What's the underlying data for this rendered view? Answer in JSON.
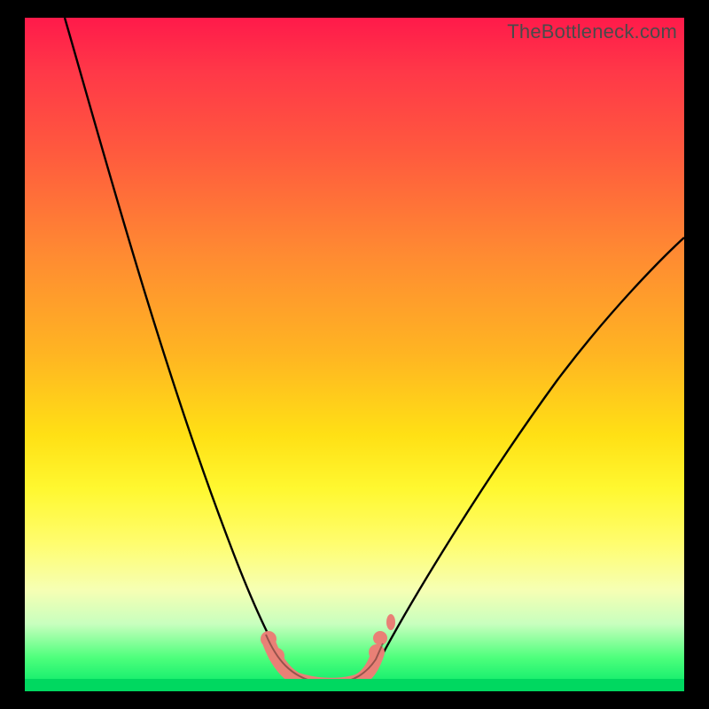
{
  "watermark": "TheBottleneck.com",
  "chart_data": {
    "type": "line",
    "title": "",
    "xlabel": "",
    "ylabel": "",
    "xlim": [
      0,
      100
    ],
    "ylim": [
      0,
      100
    ],
    "grid": false,
    "legend": false,
    "series": [
      {
        "name": "bottleneck-curve",
        "x": [
          6,
          10,
          15,
          20,
          25,
          30,
          35,
          38,
          40,
          42,
          45,
          48,
          50,
          55,
          60,
          65,
          70,
          75,
          80,
          85,
          90,
          95,
          100
        ],
        "values": [
          100,
          90,
          77,
          64,
          51,
          38,
          24,
          14,
          7,
          3,
          1,
          1,
          1.5,
          5,
          11,
          18,
          25,
          32,
          39,
          46,
          52,
          58,
          62
        ]
      }
    ],
    "markers": {
      "style": "salmon-dots-and-link",
      "points_x": [
        36.5,
        38.5,
        41,
        44,
        47,
        50,
        52,
        52.5
      ],
      "points_y": [
        7,
        4,
        1.2,
        0.8,
        0.8,
        1,
        4,
        7
      ]
    },
    "colors": {
      "curve": "#000000",
      "marker": "#e98076",
      "gradient_top": "#ff1a4a",
      "gradient_bottom": "#00e868"
    }
  }
}
